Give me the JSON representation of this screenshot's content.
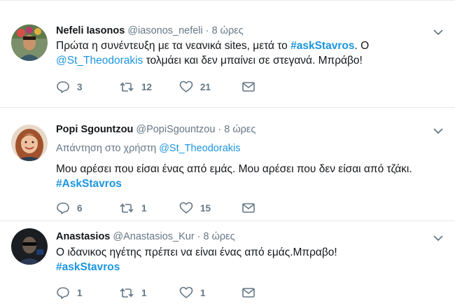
{
  "tweets": [
    {
      "name": "Nefeli Iasonos",
      "handle": "@iasonos_nefeli",
      "dot": "·",
      "time": "8 ώρες",
      "text_parts": {
        "p1": "Πρώτα η συνέντευξη με τα νεανικά sites, μετά το ",
        "hashtag": "#askStavros",
        "p2": ". Ο",
        "mention": "@St_Theodorakis",
        "p3": " τολμάει και δεν μπαίνει σε στεγανά. Μπράβο!"
      },
      "counts": {
        "replies": "3",
        "retweets": "12",
        "likes": "21"
      }
    },
    {
      "name": "Popi Sgountzou",
      "handle": "@PopiSgountzou",
      "dot": "·",
      "time": "8 ώρες",
      "reply_to_label": "Απάντηση στο χρήστη ",
      "reply_to_mention": "@St_Theodorakis",
      "text_parts": {
        "p1": "Μου αρέσει που είσαι ένας από εμάς. Μου αρέσει που δεν είσαι από τζάκι.",
        "hashtag": "#AskStavros"
      },
      "counts": {
        "replies": "6",
        "retweets": "1",
        "likes": "15"
      }
    },
    {
      "name": "Anastasios",
      "handle": "@Anastasios_Kur",
      "dot": "·",
      "time": "8 ώρες",
      "text_parts": {
        "p1": "Ο ιδανικος ηγέτης πρέπει να είναι ένας από εμάς.Μπραβο!",
        "hashtag": "#askStavros"
      },
      "counts": {
        "replies": "1",
        "retweets": "1",
        "likes": "1"
      }
    }
  ],
  "icons": {
    "reply": "reply-icon",
    "retweet": "retweet-icon",
    "like": "heart-icon",
    "dm": "envelope-icon",
    "caret": "chevron-down-icon"
  },
  "colors": {
    "link": "#1b95e0",
    "muted": "#657786",
    "text": "#14171a",
    "divider": "#e6ecf0"
  }
}
